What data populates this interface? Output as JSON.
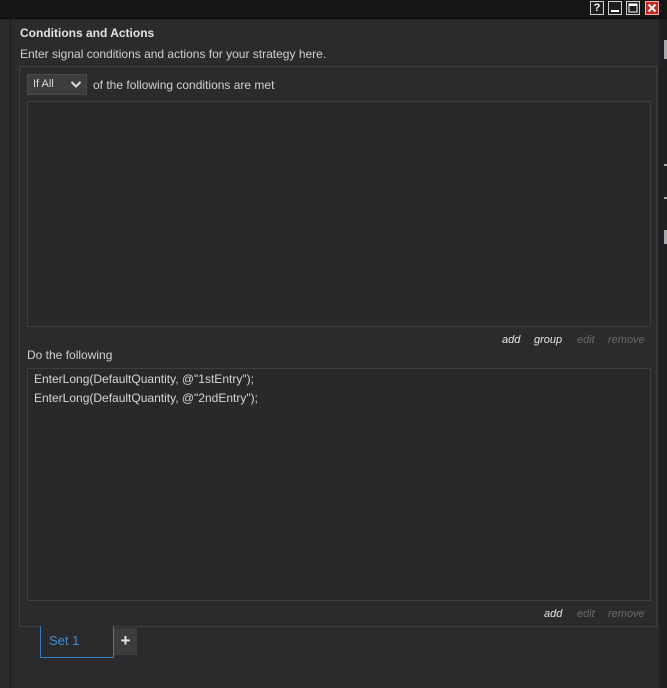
{
  "window": {
    "buttons": {
      "help": "?",
      "minimize": "minimize",
      "maximize": "maximize",
      "close": "close"
    }
  },
  "section": {
    "title": "Conditions and Actions",
    "description": "Enter signal conditions and actions for your strategy here."
  },
  "conditions": {
    "selector_value": "If All",
    "label": "of the following conditions are met",
    "links": {
      "add": "add",
      "group": "group",
      "edit": "edit",
      "remove": "remove"
    }
  },
  "actions": {
    "label": "Do the following",
    "items": [
      "EnterLong(DefaultQuantity, @\"1stEntry\");",
      "EnterLong(DefaultQuantity, @\"2ndEntry\");"
    ],
    "links": {
      "add": "add",
      "edit": "edit",
      "remove": "remove"
    }
  },
  "tabs": {
    "items": [
      "Set 1"
    ],
    "add_label": "+"
  },
  "colors": {
    "background": "#2b2b2d",
    "accent": "#3d8fd9",
    "close_button": "#c62a1e"
  }
}
